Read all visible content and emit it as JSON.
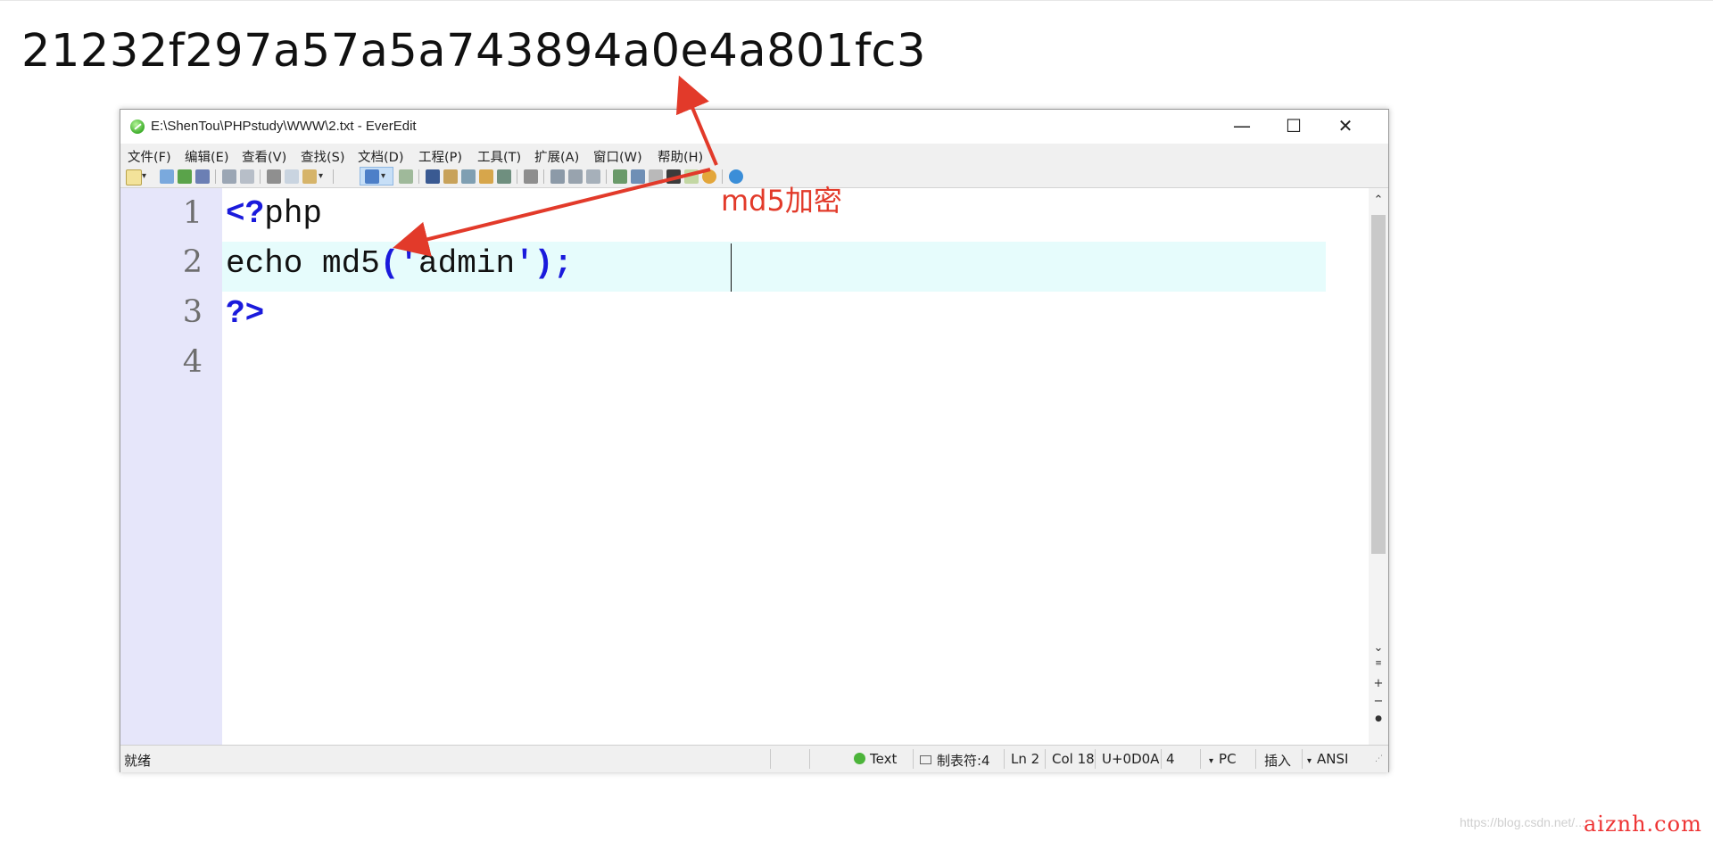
{
  "page": {
    "hash_output": "21232f297a57a5a743894a0e4a801fc3",
    "annotation_label": "md5加密",
    "accent_color": "#e23a2a"
  },
  "window": {
    "title": "E:\\ShenTou\\PHPstudy\\WWW\\2.txt - EverEdit",
    "controls": {
      "minimize": "—",
      "maximize": "☐",
      "close": "✕"
    }
  },
  "menu": {
    "items": [
      {
        "label": "文件(F)"
      },
      {
        "label": "编辑(E)"
      },
      {
        "label": "查看(V)"
      },
      {
        "label": "查找(S)"
      },
      {
        "label": "文档(D)"
      },
      {
        "label": "工程(P)"
      },
      {
        "label": "工具(T)"
      },
      {
        "label": "扩展(A)"
      },
      {
        "label": "窗口(W)"
      },
      {
        "label": "帮助(H)"
      }
    ]
  },
  "editor": {
    "line_numbers": [
      "1",
      "2",
      "3",
      "4"
    ],
    "lines": [
      {
        "kw1": "<?",
        "text": "php"
      },
      {
        "text1": "echo md5",
        "kw1": "('",
        "text2": "admin",
        "kw2": "');"
      },
      {
        "kw1": "?>"
      },
      {}
    ],
    "current_line": 2
  },
  "statusbar": {
    "ready": "就绪",
    "syntax": "Text",
    "tab": "制表符:4",
    "line": "Ln 2",
    "col": "Col 18",
    "unicode": "U+0D0A",
    "count": "4",
    "line_ending": "PC",
    "mode": "插入",
    "encoding": "ANSI"
  },
  "watermark": {
    "url": "https://blog.csdn.net/...",
    "brand": "aiznh.com"
  }
}
